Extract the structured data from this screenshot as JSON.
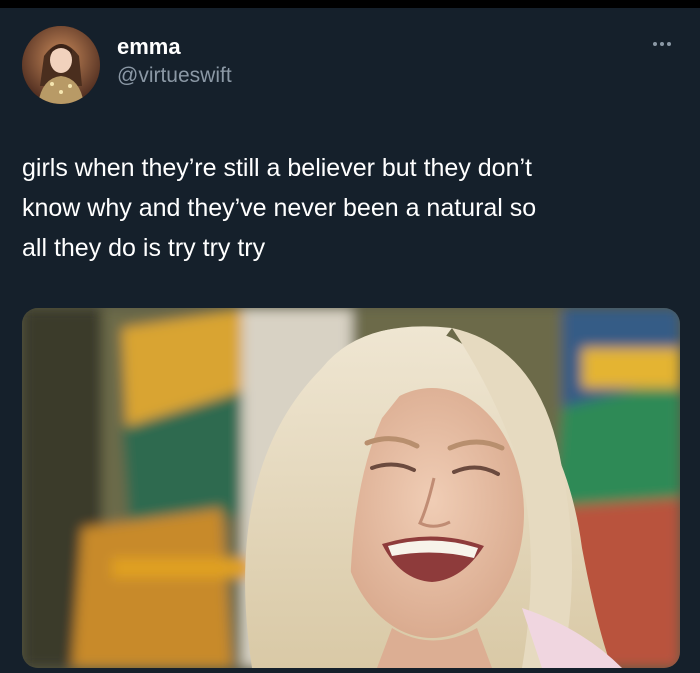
{
  "tweet": {
    "author": {
      "display_name": "emma",
      "handle": "@virtueswift",
      "avatar_icon": "avatar-photo"
    },
    "more_icon": "more-options-icon",
    "text": "girls when they’re still a believer but they don’t\nknow why and they’ve never been a natural so\nall they do is try try try",
    "media": {
      "kind": "photo",
      "icon": "image-photo"
    }
  },
  "colors": {
    "background": "#15202b",
    "text_primary": "#ffffff",
    "text_secondary": "#8b98a5"
  }
}
